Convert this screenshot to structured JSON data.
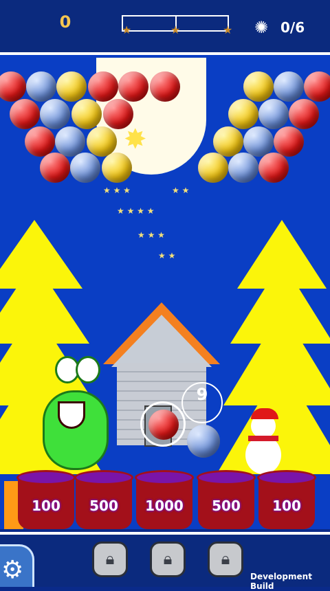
{
  "hud": {
    "score": "0",
    "star_progress": 0,
    "snowflake_counter": "0/6",
    "snowflake_icon": "snowflake-icon",
    "star_icon": "star-icon"
  },
  "colors": {
    "sky": "#0a3ec4",
    "hud": "#0b2a7e",
    "red_bubble": "#e01818",
    "blue_bubble": "#6c8fd6",
    "yellow_bubble": "#f2c514",
    "tree": "#fbf50a",
    "bucket": "#a3101a",
    "bucket_liquid": "#7a14a8"
  },
  "launcher": {
    "current_bubble": "red",
    "next_bubble": "blue",
    "shots_left": "9"
  },
  "buckets": [
    {
      "label": "100"
    },
    {
      "label": "500"
    },
    {
      "label": "1000"
    },
    {
      "label": "500"
    },
    {
      "label": "100"
    }
  ],
  "bottom_bar": {
    "settings_icon": "gear-icon",
    "lock_icon": "lock-icon",
    "dev_build": "Development Build"
  }
}
